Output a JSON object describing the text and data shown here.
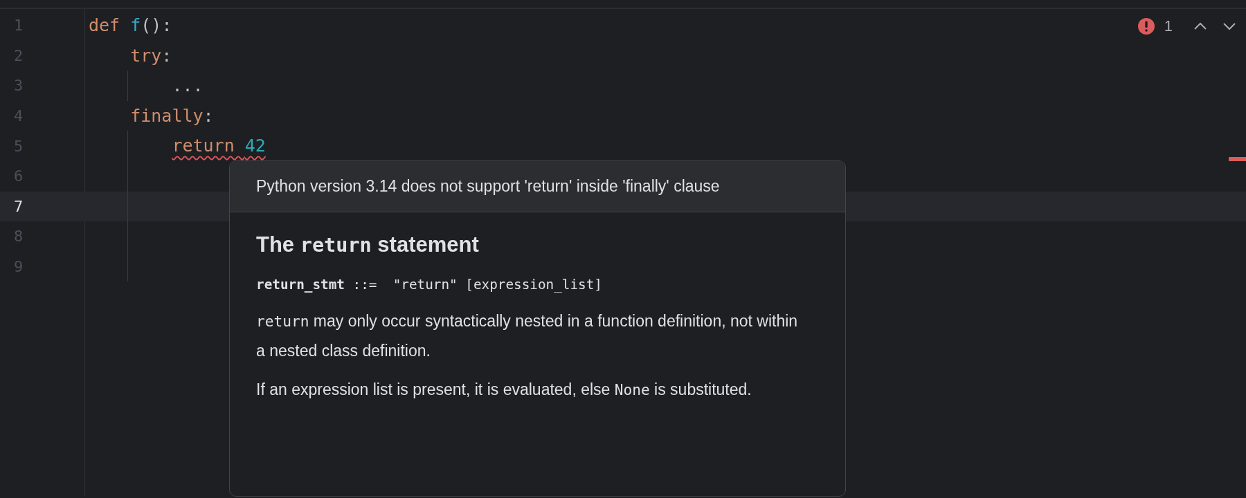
{
  "editor": {
    "lines": [
      {
        "number": "1",
        "current": false,
        "tokens": [
          {
            "text": "def ",
            "kind": "keyword"
          },
          {
            "text": "f",
            "kind": "function"
          },
          {
            "text": "():",
            "kind": "plain"
          }
        ],
        "children": [
          {
            "number": "2",
            "current": false,
            "tokens": [
              {
                "text": "try",
                "kind": "keyword"
              },
              {
                "text": ":",
                "kind": "plain"
              }
            ],
            "children": [
              {
                "number": "3",
                "current": false,
                "tokens": [
                  {
                    "text": "...",
                    "kind": "plain"
                  }
                ]
              }
            ]
          },
          {
            "number": "4",
            "current": false,
            "tokens": [
              {
                "text": "finally",
                "kind": "keyword"
              },
              {
                "text": ":",
                "kind": "plain"
              }
            ],
            "children": [
              {
                "number": "5",
                "current": false,
                "error": true,
                "tokens": [
                  {
                    "text": "return ",
                    "kind": "keyword"
                  },
                  {
                    "text": "42",
                    "kind": "number"
                  }
                ]
              },
              {
                "number": "6",
                "current": false
              },
              {
                "number": "7",
                "current": true
              },
              {
                "number": "8",
                "current": false
              },
              {
                "number": "9",
                "current": false
              }
            ]
          }
        ]
      }
    ]
  },
  "problems": {
    "count": "1"
  },
  "popup": {
    "header": "Python version 3.14 does not support 'return' inside 'finally' clause",
    "title": [
      {
        "text": "The ",
        "kind": "text"
      },
      {
        "text": "return",
        "kind": "code"
      },
      {
        "text": " statement",
        "kind": "text"
      }
    ],
    "grammar": [
      {
        "text": "return_stmt",
        "kind": "code-bold"
      },
      {
        "text": " ::=  \"return\" [expression_list]",
        "kind": "code"
      }
    ],
    "paragraphs": [
      [
        {
          "text": "return",
          "kind": "code"
        },
        {
          "text": " may only occur syntactically nested in a function definition, not within a nested class definition.",
          "kind": "text"
        }
      ],
      [
        {
          "text": "If an expression list is present, it is evaluated, else ",
          "kind": "text"
        },
        {
          "text": "None",
          "kind": "code"
        },
        {
          "text": " is substituted.",
          "kind": "text"
        }
      ]
    ]
  }
}
